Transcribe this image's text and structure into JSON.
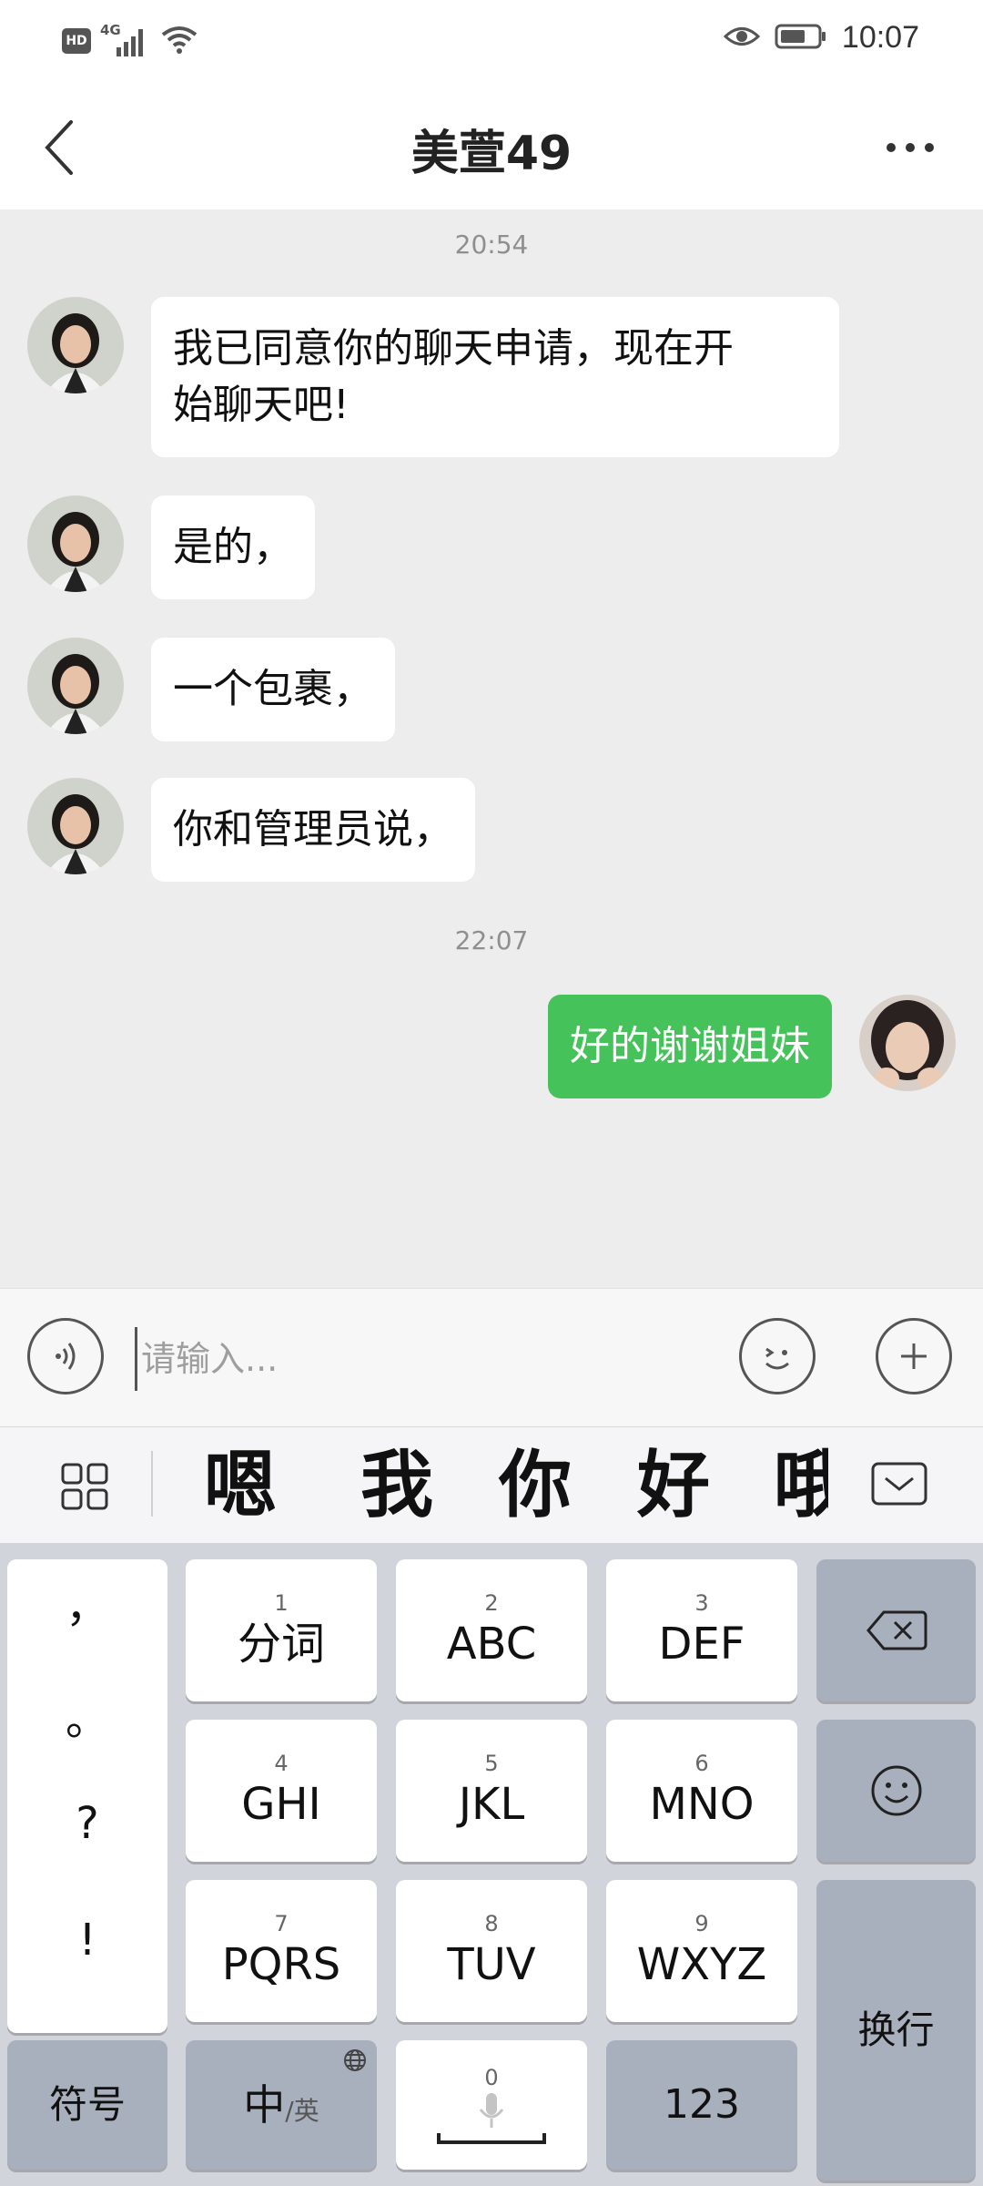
{
  "status_bar": {
    "network": "4G",
    "hd": "HD",
    "time": "10:07"
  },
  "header": {
    "title": "美萱49"
  },
  "chat": {
    "timestamp_1": "20:54",
    "timestamp_2": "22:07",
    "messages": [
      {
        "text": "我已同意你的聊天申请，现在开始聊天吧!",
        "line1": "我已同意你的聊天申请，现在开",
        "line2": "始聊天吧!"
      },
      {
        "text": "是的，"
      },
      {
        "text": "一个包裹，"
      },
      {
        "text": "你和管理员说，"
      },
      {
        "text": "好的谢谢姐妹"
      }
    ]
  },
  "input": {
    "placeholder": "请输入..."
  },
  "candidates": [
    "嗯",
    "我",
    "你",
    "好",
    "哦"
  ],
  "keyboard": {
    "punctuation": [
      "，",
      "。",
      "?",
      "!"
    ],
    "keys": [
      {
        "num": "1",
        "label": "分词"
      },
      {
        "num": "2",
        "label": "ABC"
      },
      {
        "num": "3",
        "label": "DEF"
      },
      {
        "num": "4",
        "label": "GHI"
      },
      {
        "num": "5",
        "label": "JKL"
      },
      {
        "num": "6",
        "label": "MNO"
      },
      {
        "num": "7",
        "label": "PQRS"
      },
      {
        "num": "8",
        "label": "TUV"
      },
      {
        "num": "9",
        "label": "WXYZ"
      }
    ],
    "symbols": "符号",
    "lang_main": "中",
    "lang_alt": "/英",
    "space_num": "0",
    "numbers": "123",
    "enter": "换行"
  },
  "colors": {
    "sent_bubble": "#45c25a",
    "background": "#ededed",
    "keyboard_bg": "#d2d4db",
    "dark_key": "#a9b0bd"
  }
}
